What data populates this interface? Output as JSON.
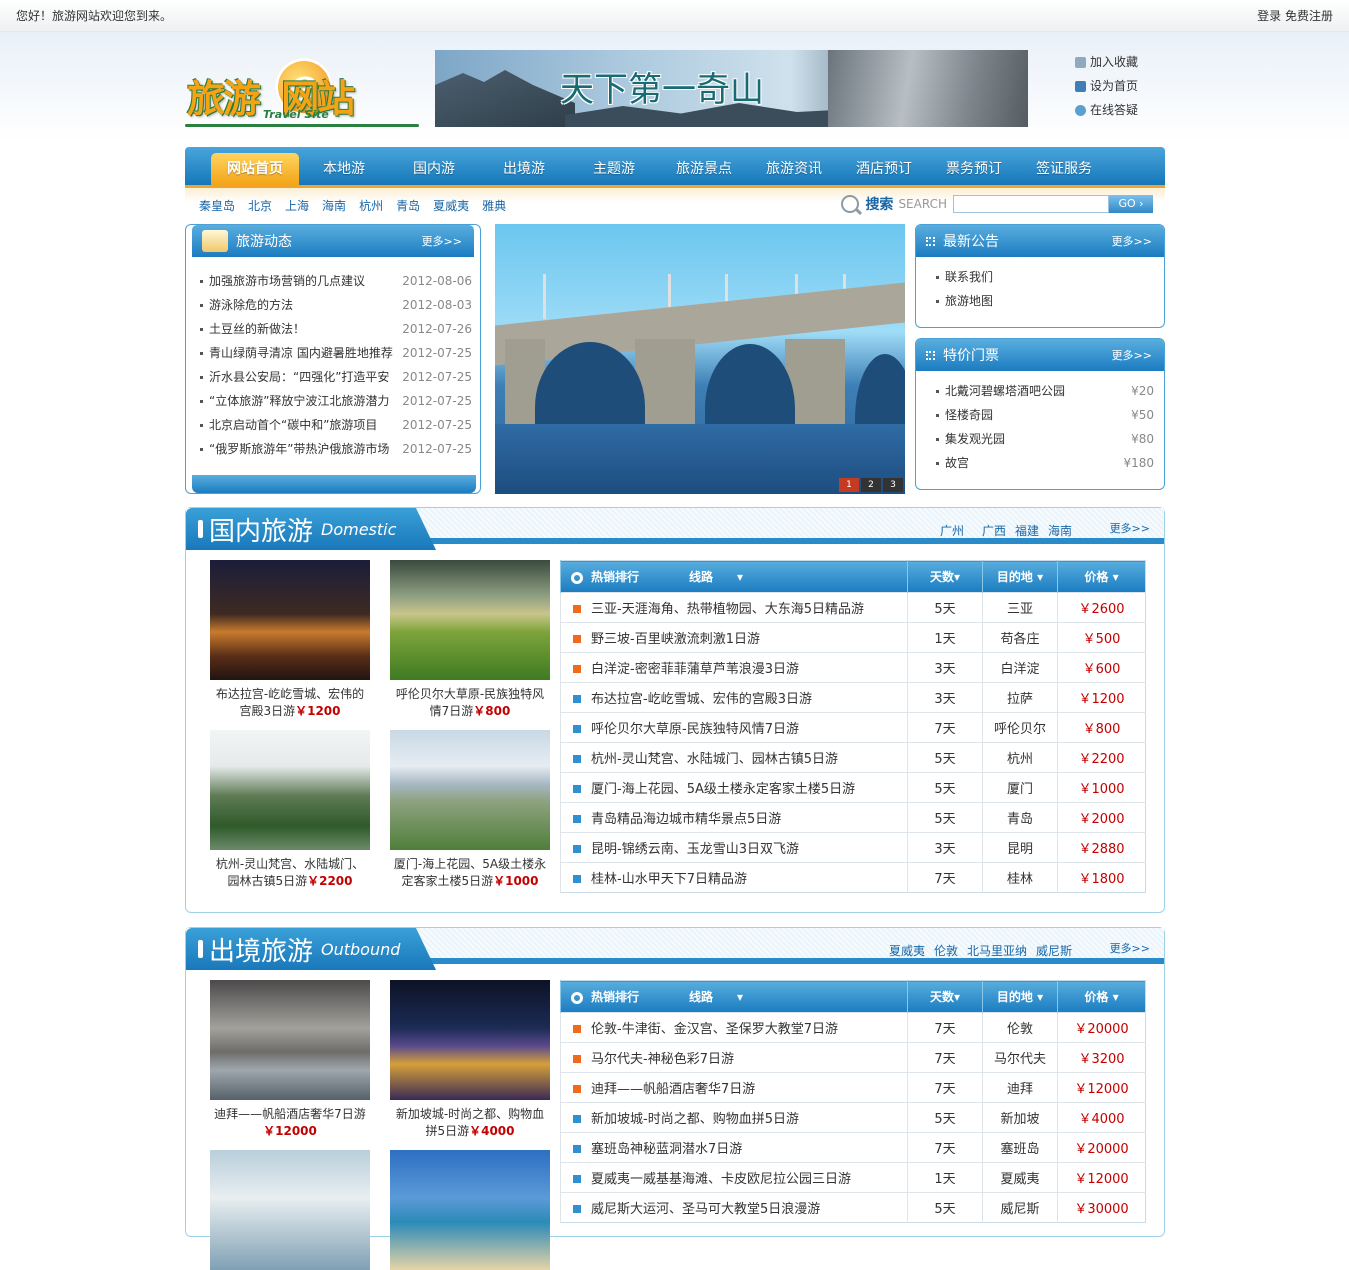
{
  "topbar": {
    "welcome": "您好！旅游网站欢迎您到来。",
    "login": "登录",
    "register": "免费注册"
  },
  "logo": {
    "text": "旅游e网站",
    "sub": "Travel Site"
  },
  "banner": {
    "text": "天下第一奇山"
  },
  "quick": [
    "加入收藏",
    "设为首页",
    "在线答疑"
  ],
  "nav": [
    "网站首页",
    "本地游",
    "国内游",
    "出境游",
    "主题游",
    "旅游景点",
    "旅游资讯",
    "酒店预订",
    "票务预订",
    "签证服务"
  ],
  "cities": [
    "秦皇岛",
    "北京",
    "上海",
    "海南",
    "杭州",
    "青岛",
    "夏威夷",
    "雅典"
  ],
  "search": {
    "label": "搜索",
    "en": "SEARCH",
    "go": "GO"
  },
  "news": {
    "title": "旅游动态",
    "more": "更多>>",
    "items": [
      {
        "t": "加强旅游市场营销的几点建议",
        "d": "2012-08-06"
      },
      {
        "t": "游泳除危的方法",
        "d": "2012-08-03"
      },
      {
        "t": "土豆丝的新做法！",
        "d": "2012-07-26"
      },
      {
        "t": "青山绿荫寻清凉 国内避暑胜地推荐",
        "d": "2012-07-25"
      },
      {
        "t": "沂水县公安局：“四强化”打造平安",
        "d": "2012-07-25"
      },
      {
        "t": "“立体旅游”释放宁波江北旅游潜力",
        "d": "2012-07-25"
      },
      {
        "t": "北京启动首个“碳中和”旅游项目",
        "d": "2012-07-25"
      },
      {
        "t": "“俄罗斯旅游年”带热沪俄旅游市场",
        "d": "2012-07-25"
      }
    ]
  },
  "pager": [
    "1",
    "2",
    "3"
  ],
  "notice": {
    "title": "最新公告",
    "more": "更多>>",
    "items": [
      "联系我们",
      "旅游地图"
    ]
  },
  "tickets": {
    "title": "特价门票",
    "more": "更多>>",
    "items": [
      {
        "n": "北戴河碧螺塔酒吧公园",
        "p": "¥20"
      },
      {
        "n": "怪楼奇园",
        "p": "¥50"
      },
      {
        "n": "集发观光园",
        "p": "¥80"
      },
      {
        "n": "故宫",
        "p": "¥180"
      }
    ]
  },
  "domestic": {
    "cn": "国内旅游",
    "en": "Domestic",
    "cities": [
      "广州",
      "广西",
      "福建",
      "海南"
    ],
    "more": "更多>>",
    "pics": [
      {
        "cap": "布达拉宫-屹屹雪城、宏伟的宫殿3日游",
        "price": "￥1200"
      },
      {
        "cap": "呼伦贝尔大草原-民族独特风情7日游",
        "price": "￥800"
      },
      {
        "cap": "杭州-灵山梵宫、水陆城门、园林古镇5日游",
        "price": "￥2200"
      },
      {
        "cap": "厦门-海上花园、5A级土楼永定客家土楼5日游",
        "price": "￥1000"
      }
    ],
    "head": {
      "rank": "热销排行",
      "route": "线路",
      "days": "天数",
      "dest": "目的地",
      "price": "价格"
    },
    "rows": [
      [
        "三亚-天涯海角、热带植物园、大东海5日精品游",
        "5天",
        "三亚",
        "￥2600"
      ],
      [
        "野三坡-百里峡激流刺激1日游",
        "1天",
        "苟各庄",
        "￥500"
      ],
      [
        "白洋淀-密密菲菲蒲草芦苇浪漫3日游",
        "3天",
        "白洋淀",
        "￥600"
      ],
      [
        "布达拉宫-屹屹雪城、宏伟的宫殿3日游",
        "3天",
        "拉萨",
        "￥1200"
      ],
      [
        "呼伦贝尔大草原-民族独特风情7日游",
        "7天",
        "呼伦贝尔",
        "￥800"
      ],
      [
        "杭州-灵山梵宫、水陆城门、园林古镇5日游",
        "5天",
        "杭州",
        "￥2200"
      ],
      [
        "厦门-海上花园、5A级土楼永定客家土楼5日游",
        "5天",
        "厦门",
        "￥1000"
      ],
      [
        "青岛精品海边城市精华景点5日游",
        "5天",
        "青岛",
        "￥2000"
      ],
      [
        "昆明-锦绣云南、玉龙雪山3日双飞游",
        "3天",
        "昆明",
        "￥2880"
      ],
      [
        "桂林-山水甲天下7日精品游",
        "7天",
        "桂林",
        "￥1800"
      ]
    ]
  },
  "outbound": {
    "cn": "出境旅游",
    "en": "Outbound",
    "cities": [
      "夏威夷",
      "伦敦",
      "北马里亚纳",
      "威尼斯"
    ],
    "more": "更多>>",
    "pics": [
      {
        "cap": "迪拜——帆船酒店奢华7日游",
        "price": "￥12000"
      },
      {
        "cap": "新加坡城-时尚之都、购物血拼5日游",
        "price": "￥4000"
      }
    ],
    "head": {
      "rank": "热销排行",
      "route": "线路",
      "days": "天数",
      "dest": "目的地",
      "price": "价格"
    },
    "rows": [
      [
        "伦敦-牛津街、金汉宫、圣保罗大教堂7日游",
        "7天",
        "伦敦",
        "￥20000"
      ],
      [
        "马尔代夫-神秘色彩7日游",
        "7天",
        "马尔代夫",
        "￥3200"
      ],
      [
        "迪拜——帆船酒店奢华7日游",
        "7天",
        "迪拜",
        "￥12000"
      ],
      [
        "新加坡城-时尚之都、购物血拼5日游",
        "5天",
        "新加坡",
        "￥4000"
      ],
      [
        "塞班岛神秘蓝洞潜水7日游",
        "7天",
        "塞班岛",
        "￥20000"
      ],
      [
        "夏威夷一威基基海滩、卡皮欧尼拉公园三日游",
        "1天",
        "夏威夷",
        "￥12000"
      ],
      [
        "威尼斯大运河、圣马可大教堂5日浪漫游",
        "5天",
        "威尼斯",
        "￥30000"
      ]
    ]
  },
  "colors": {
    "primary": "#1b7cc1",
    "accent": "#f3a418",
    "price": "#c40000"
  }
}
